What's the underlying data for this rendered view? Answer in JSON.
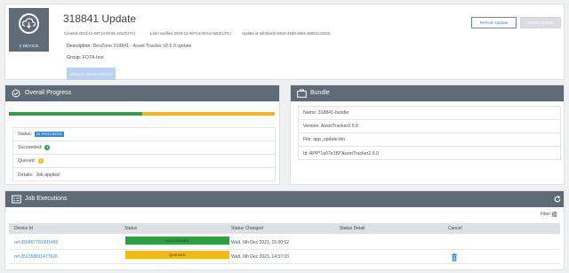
{
  "header": {
    "tile_label": "2 DEVICE",
    "title": "318841 Update",
    "created": "Created 2023-12-06T14:00:55.191Z(UTC)",
    "modified": "Last modified 2023-12-06T14:00:52.066Z(UTC)",
    "update_id": "Update id 3d03ab1b-5910-48d8-a504-a5053131816",
    "refresh_label": "Refresh Update",
    "delete_label": "Delete Update",
    "description_label": "Description:",
    "description_value": "DevZone 318841 - Asset Tracker v2.5.0 update",
    "group_label": "Group:",
    "group_value": "FOTA-test",
    "status_button": "UPDATE IN PROGRESS"
  },
  "overall": {
    "title": "Overall Progress",
    "progress_fraction": 0.5,
    "status_label": "Status:",
    "status_value": "IN PROGRESS",
    "succeeded_label": "Succeeded:",
    "succeeded_count": "1",
    "queued_label": "Queued:",
    "queued_count": "1",
    "details_label": "Details:",
    "details_value": "Job applied"
  },
  "bundle": {
    "title": "Bundle",
    "name": "Name: 318841-bundle",
    "version": "Version: AssetTracker2.5.0",
    "file": "File: app_update.bin",
    "id": "Id: APP*1a07e1f9*AssetTracker2.5.0"
  },
  "jobs": {
    "title": "Job Executions",
    "filter_label": "Filter",
    "columns": [
      "Device Id",
      "Status",
      "Status Changed",
      "Status Detail",
      "Cancel"
    ],
    "rows": [
      {
        "device_id": "nrf-350457791991456",
        "status": "SUCCEEDED",
        "changed": "Wed, 6th Dec 2023, 15:00:52",
        "cancel": false
      },
      {
        "device_id": "nrf-351358811477626",
        "status": "QUEUED",
        "changed": "Wed, 6th Dec 2023, 14:57:03",
        "cancel": true
      }
    ]
  },
  "colors": {
    "panel_header": "#5e6a76",
    "accent_blue": "#3b8ad6",
    "succeeded_green": "#2f9e44",
    "queued_yellow": "#f2b817"
  }
}
